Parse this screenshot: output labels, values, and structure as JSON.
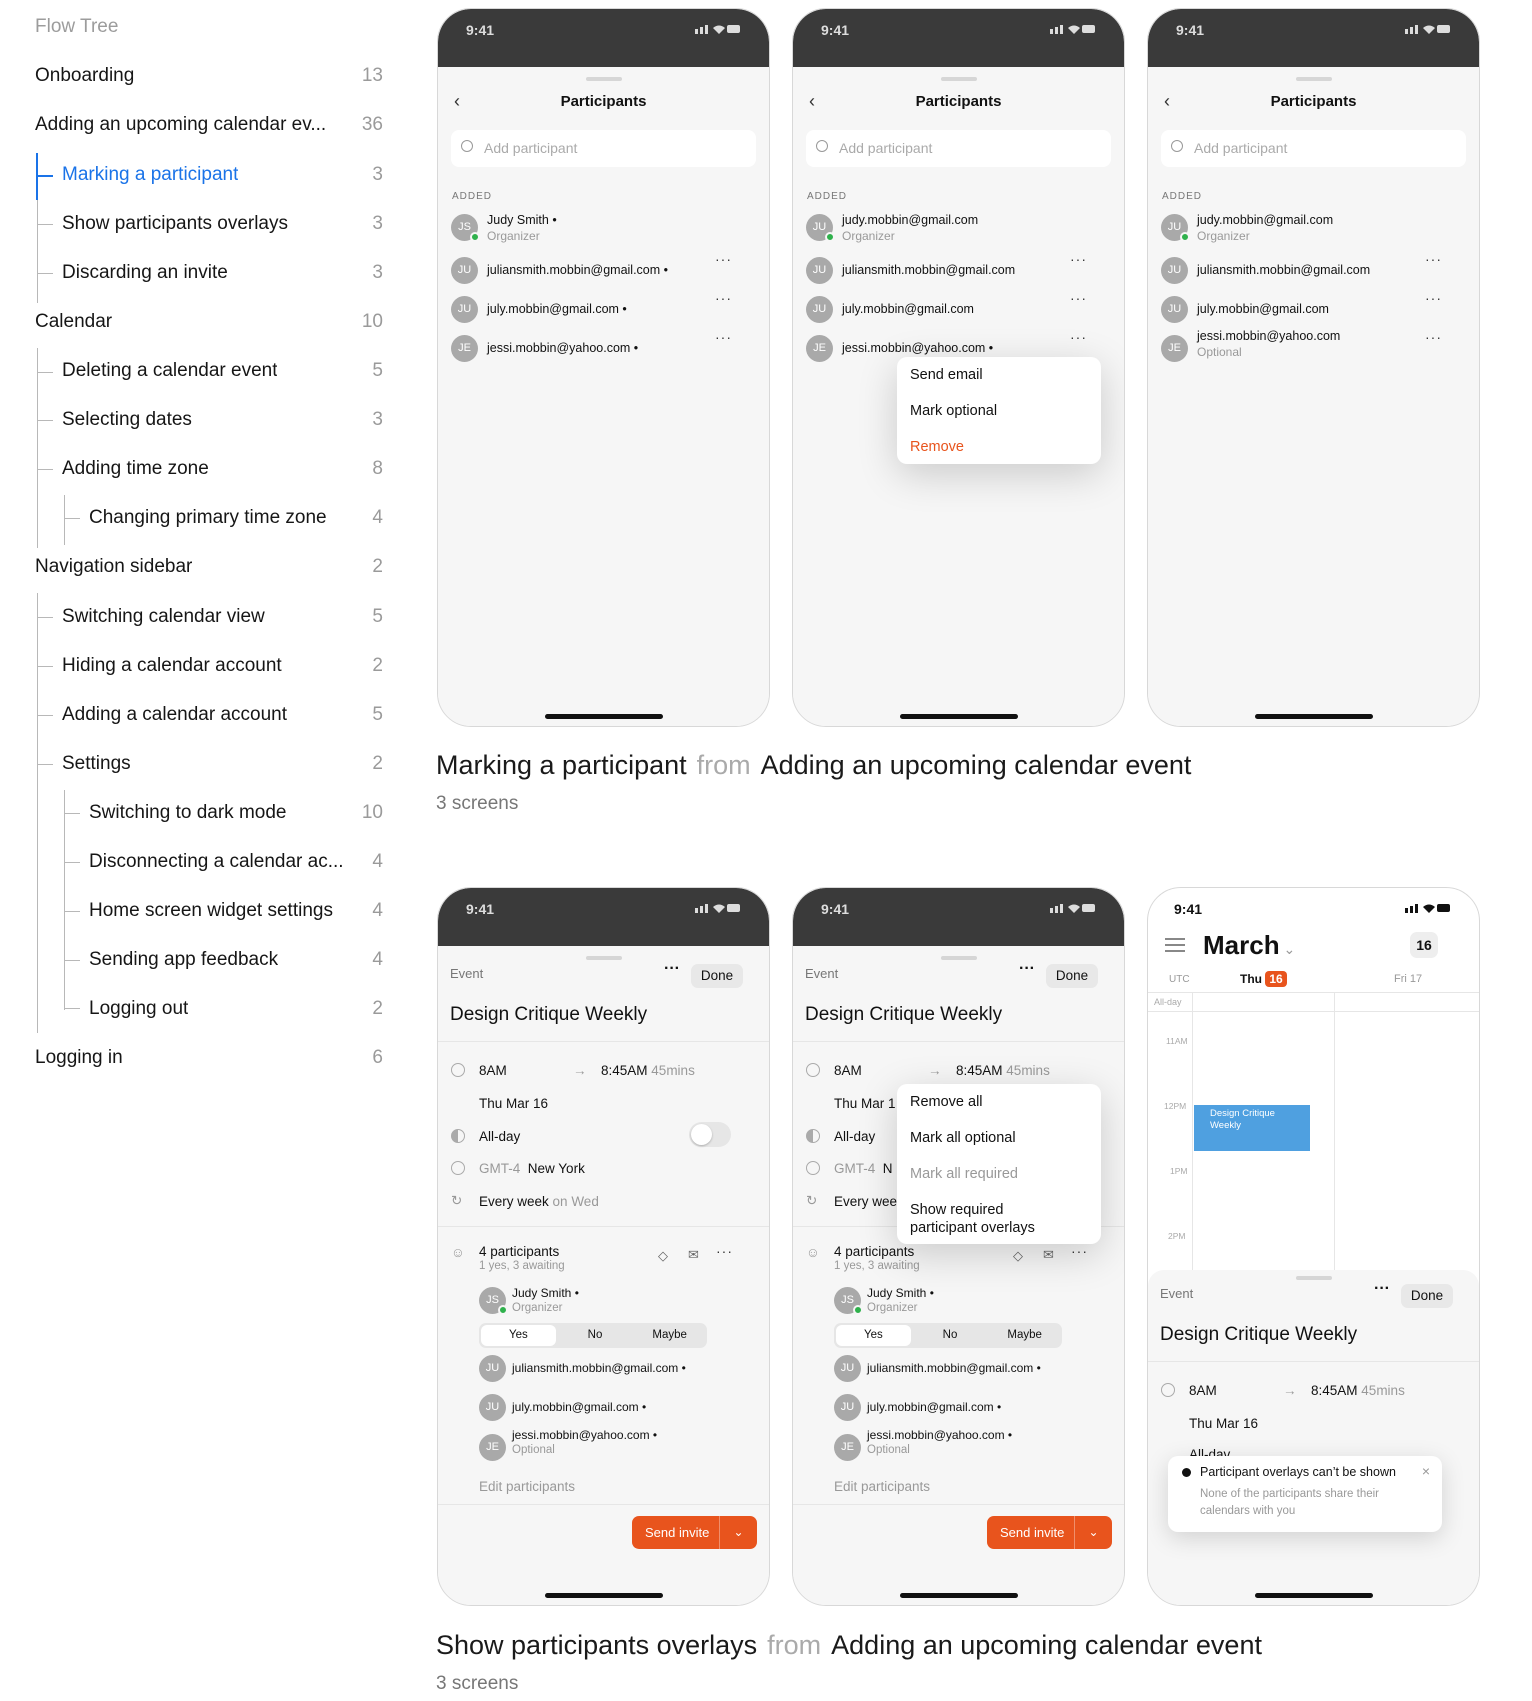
{
  "flow_tree": {
    "title": "Flow Tree",
    "items": [
      {
        "label": "Onboarding",
        "count": "13"
      },
      {
        "label": "Adding an upcoming calendar ev...",
        "count": "36"
      },
      {
        "label": "Marking a participant",
        "count": "3"
      },
      {
        "label": "Show participants overlays",
        "count": "3"
      },
      {
        "label": "Discarding an invite",
        "count": "3"
      },
      {
        "label": "Calendar",
        "count": "10"
      },
      {
        "label": "Deleting a calendar event",
        "count": "5"
      },
      {
        "label": "Selecting dates",
        "count": "3"
      },
      {
        "label": "Adding time zone",
        "count": "8"
      },
      {
        "label": "Changing primary time zone",
        "count": "4"
      },
      {
        "label": "Navigation sidebar",
        "count": "2"
      },
      {
        "label": "Switching calendar view",
        "count": "5"
      },
      {
        "label": "Hiding a calendar account",
        "count": "2"
      },
      {
        "label": "Adding a calendar account",
        "count": "5"
      },
      {
        "label": "Settings",
        "count": "2"
      },
      {
        "label": "Switching to dark mode",
        "count": "10"
      },
      {
        "label": "Disconnecting a calendar ac...",
        "count": "4"
      },
      {
        "label": "Home screen widget settings",
        "count": "4"
      },
      {
        "label": "Sending app feedback",
        "count": "4"
      },
      {
        "label": "Logging out",
        "count": "2"
      },
      {
        "label": "Logging in",
        "count": "6"
      }
    ]
  },
  "status_time": "9:41",
  "participants_screen": {
    "title": "Participants",
    "search_placeholder": "Add participant",
    "section": "ADDED",
    "organizer": "Organizer",
    "optional": "Optional",
    "initials": {
      "js": "JS",
      "ju": "JU",
      "je": "JE"
    },
    "judy_name": "Judy Smith",
    "judy_email": "judy.mobbin@gmail.com",
    "julian": "juliansmith.mobbin@gmail.com",
    "july": "july.mobbin@gmail.com",
    "jessi": "jessi.mobbin@yahoo.com",
    "menu": {
      "send_email": "Send email",
      "mark_optional": "Mark optional",
      "remove": "Remove"
    }
  },
  "section1": {
    "title": "Marking a participant",
    "from": "from",
    "parent": "Adding an upcoming calendar event",
    "screens": "3 screens"
  },
  "section2": {
    "title": "Show participants overlays",
    "from": "from",
    "parent": "Adding an upcoming calendar event",
    "screens": "3 screens"
  },
  "event_screen": {
    "header": "Event",
    "done": "Done",
    "title": "Design Critique Weekly",
    "start": "8AM",
    "end": "8:45AM",
    "duration": "45mins",
    "date": "Thu Mar 16",
    "allday": "All-day",
    "tz_code": "GMT-4",
    "tz_name": "New York",
    "repeat": "Every week",
    "repeat_day": "on Wed",
    "participants_count": "4 participants",
    "participants_status": "1 yes, 3 awaiting",
    "rsvp": {
      "yes": "Yes",
      "no": "No",
      "maybe": "Maybe"
    },
    "edit": "Edit participants",
    "send": "Send invite",
    "menu": {
      "remove_all": "Remove all",
      "mark_all_optional": "Mark all optional",
      "mark_all_required": "Mark all required",
      "show_overlays_1": "Show required",
      "show_overlays_2": "participant overlays"
    },
    "truncated_date": "Thu Mar 1",
    "truncated_repeat": "Every wee",
    "truncated_tz": "N",
    "truncated_allday": "All-dav"
  },
  "calendar_screen": {
    "month": "March",
    "today_badge": "16",
    "utc": "UTC",
    "day1": "Thu",
    "day1_num": "16",
    "day2": "Fri 17",
    "allday": "All-day",
    "times": [
      "11AM",
      "12PM",
      "1PM",
      "2PM"
    ],
    "event": "Design Critique Weekly",
    "toast_title": "Participant overlays can’t be shown",
    "toast_body_1": "None of the participants share their",
    "toast_body_2": "calendars with you"
  }
}
